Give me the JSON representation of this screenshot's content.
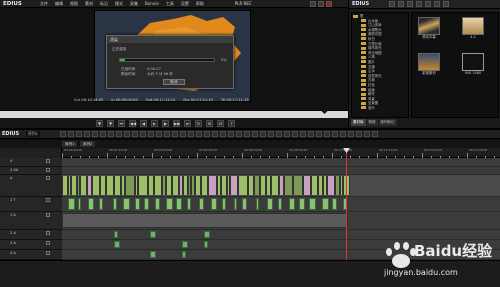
{
  "app": {
    "title": "EDIUS"
  },
  "menubar": {
    "items": [
      "文件",
      "编辑",
      "视图",
      "素材",
      "标记",
      "模式",
      "采集",
      "Bonnie",
      "工具",
      "设置",
      "帮助"
    ],
    "status_right": "PLR REC"
  },
  "dialog": {
    "title": "渲染",
    "section": "正在渲染",
    "percent": "0%",
    "progress": 0.05,
    "elapsed_label": "已用时间",
    "elapsed_value": "0:00:27",
    "remaining_label": "剩余时间",
    "remaining_value": "大约 9 分 46 秒",
    "cancel_label": "取消"
  },
  "timecodes": {
    "cur": "Cur 00:10:14:03",
    "in": "In 00:00:00:00",
    "out": "Out 00:17:11:15",
    "dur": "Dur 00:17:11:15",
    "ttl": "Ttl 00:17:11:15"
  },
  "bin": {
    "title": "EDIUS",
    "root": "根",
    "folders": [
      "山水画",
      "江山多娇",
      "水调歌头",
      "美丽中国",
      "秋日",
      "万里长城",
      "城市风光",
      "风光地图",
      "人物",
      "图片",
      "交通",
      "山水",
      "自然风光",
      "古典",
      "红色",
      "绘画",
      "朝代",
      "风景",
      "全景图",
      "音乐"
    ],
    "thumbs": [
      {
        "label": "滚动字幕"
      },
      {
        "label": "4-2"
      },
      {
        "label": "影视素材"
      },
      {
        "label": "IMG 1080"
      }
    ],
    "tabs": [
      "素材库",
      "特效",
      "序列标记"
    ]
  },
  "timeline": {
    "sequence_name": "序列1",
    "seq_tabs": [
      "序列1",
      "序列2"
    ],
    "tracks": [
      {
        "name": "V",
        "type": "video"
      },
      {
        "name": "1 VA",
        "type": "video"
      },
      {
        "name": "A",
        "type": "audio"
      },
      {
        "name": "1 T",
        "type": "title"
      },
      {
        "name": "1 A",
        "type": "audio"
      },
      {
        "name": "2 A",
        "type": "audio"
      },
      {
        "name": "3 A",
        "type": "audio"
      },
      {
        "name": "4 A",
        "type": "audio"
      }
    ],
    "ruler_labels": [
      "00:00:00;00",
      "00:01:40;00",
      "00:03:20;00",
      "00:05:00;00",
      "00:06:40;00",
      "00:08:20;00",
      "00:10:00;00",
      "00:11:40;00",
      "00:13:20;00",
      "00:15:00;00"
    ]
  },
  "watermark": {
    "brand": "Baidu经验",
    "url": "jingyan.baidu.com"
  },
  "colors": {
    "progress": "#2fb52f",
    "clip_video": "#9cbf68",
    "clip_audio": "#6fb16f",
    "playhead": "#dd3333"
  }
}
